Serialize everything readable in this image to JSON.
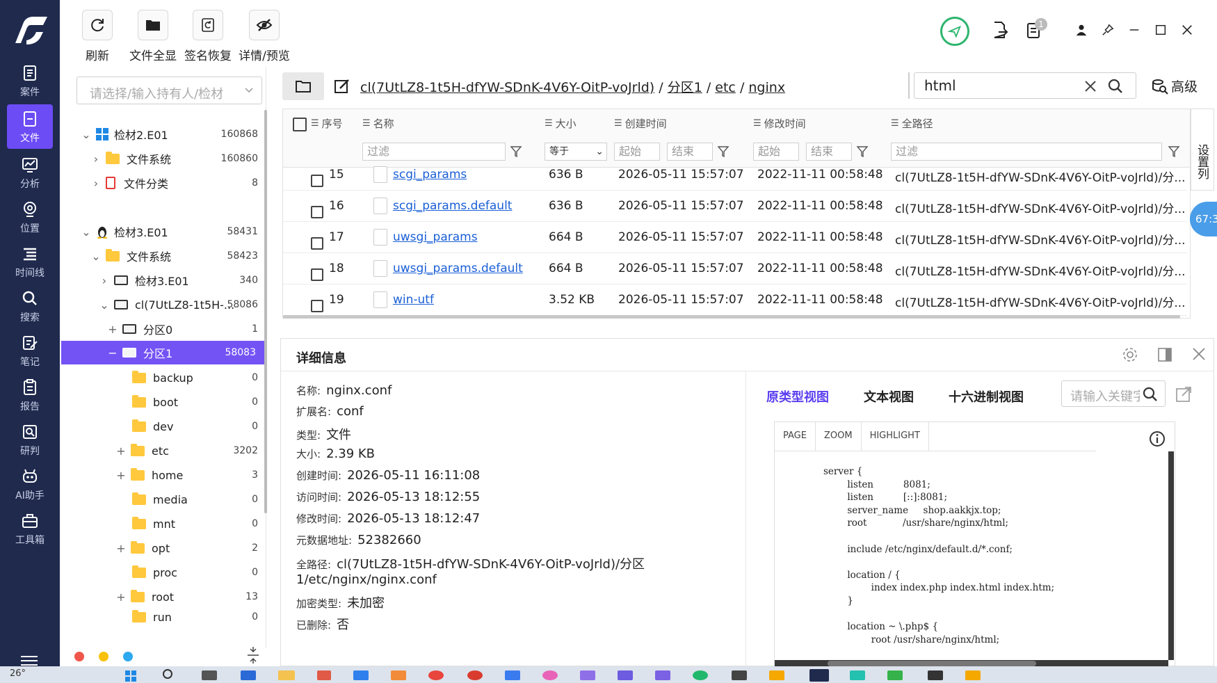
{
  "toolbar": {
    "refresh": "刷新",
    "all_files": "文件全显",
    "sig_restore": "签名恢复",
    "detail_preview": "详情/预览"
  },
  "rail": {
    "items": [
      {
        "label": "案件"
      },
      {
        "label": "文件"
      },
      {
        "label": "分析"
      },
      {
        "label": "位置"
      },
      {
        "label": "时间线"
      },
      {
        "label": "搜索"
      },
      {
        "label": "笔记"
      },
      {
        "label": "报告"
      },
      {
        "label": "研判"
      },
      {
        "label": "AI助手"
      },
      {
        "label": "工具箱"
      }
    ]
  },
  "header": {
    "badge_count": "1"
  },
  "owner_select": {
    "placeholder": "请选择/输入持有人/检材"
  },
  "tree": [
    {
      "label": "检材2.E01",
      "count": "160868"
    },
    {
      "label": "文件系统",
      "count": "160860"
    },
    {
      "label": "文件分类",
      "count": "8"
    },
    {
      "label": "检材3.E01",
      "count": "58431"
    },
    {
      "label": "文件系统",
      "count": "58423"
    },
    {
      "label": "检材3.E01",
      "count": "340"
    },
    {
      "label": "cl(7UtLZ8-1t5H-...",
      "count": "58086"
    },
    {
      "label": "分区0",
      "count": "1"
    },
    {
      "label": "分区1",
      "count": "58083"
    },
    {
      "label": "backup",
      "count": "0"
    },
    {
      "label": "boot",
      "count": "0"
    },
    {
      "label": "dev",
      "count": "0"
    },
    {
      "label": "etc",
      "count": "3202"
    },
    {
      "label": "home",
      "count": "3"
    },
    {
      "label": "media",
      "count": "0"
    },
    {
      "label": "mnt",
      "count": "0"
    },
    {
      "label": "opt",
      "count": "2"
    },
    {
      "label": "proc",
      "count": "0"
    },
    {
      "label": "root",
      "count": "13"
    },
    {
      "label": "run",
      "count": "0"
    }
  ],
  "path": {
    "root": "cl(7UtLZ8-1t5H-dfYW-SDnK-4V6Y-OitP-voJrld)",
    "sep": "/",
    "p1": "分区1",
    "p2": "etc",
    "p3": "nginx"
  },
  "search": {
    "value": "html",
    "advanced": "高级"
  },
  "grid": {
    "columns": {
      "index": "序号",
      "name": "名称",
      "size": "大小",
      "created": "创建时间",
      "modified": "修改时间",
      "fullpath": "全路径"
    },
    "filters": {
      "filter": "过滤",
      "equals": "等于",
      "start": "起始",
      "end": "结束"
    },
    "side_label": "设置列",
    "rows": [
      {
        "index": "15",
        "name": "scgi_params",
        "size": "636 B",
        "created": "2026-05-11 15:57:07",
        "modified": "2022-11-11 00:58:48",
        "path": "cl(7UtLZ8-1t5H-dfYW-SDnK-4V6Y-OitP-voJrld)/分..."
      },
      {
        "index": "16",
        "name": "scgi_params.default",
        "size": "636 B",
        "created": "2026-05-11 15:57:07",
        "modified": "2022-11-11 00:58:48",
        "path": "cl(7UtLZ8-1t5H-dfYW-SDnK-4V6Y-OitP-voJrld)/分..."
      },
      {
        "index": "17",
        "name": "uwsgi_params",
        "size": "664 B",
        "created": "2026-05-11 15:57:07",
        "modified": "2022-11-11 00:58:48",
        "path": "cl(7UtLZ8-1t5H-dfYW-SDnK-4V6Y-OitP-voJrld)/分..."
      },
      {
        "index": "18",
        "name": "uwsgi_params.default",
        "size": "664 B",
        "created": "2026-05-11 15:57:07",
        "modified": "2022-11-11 00:58:48",
        "path": "cl(7UtLZ8-1t5H-dfYW-SDnK-4V6Y-OitP-voJrld)/分..."
      },
      {
        "index": "19",
        "name": "win-utf",
        "size": "3.52 KB",
        "created": "2026-05-11 15:57:07",
        "modified": "2022-11-11 00:58:48",
        "path": "cl(7UtLZ8-1t5H-dfYW-SDnK-4V6Y-OitP-voJrld)/分..."
      }
    ]
  },
  "float_badge": "67:3",
  "details": {
    "title": "详细信息",
    "fields": [
      {
        "label": "名称:",
        "value": "nginx.conf"
      },
      {
        "label": "扩展名:",
        "value": "conf"
      },
      {
        "label": "类型:",
        "value": "文件"
      },
      {
        "label": "大小:",
        "value": "2.39 KB"
      },
      {
        "label": "创建时间:",
        "value": "2026-05-11 16:11:08"
      },
      {
        "label": "访问时间:",
        "value": "2026-05-13 18:12:55"
      },
      {
        "label": "修改时间:",
        "value": "2026-05-13 18:12:47"
      },
      {
        "label": "元数据地址:",
        "value": "52382660"
      },
      {
        "label": "全路径:",
        "value": "cl(7UtLZ8-1t5H-dfYW-SDnK-4V6Y-OitP-voJrld)/分区"
      },
      {
        "label": "",
        "value": "1/etc/nginx/nginx.conf"
      },
      {
        "label": "加密类型:",
        "value": "未加密"
      },
      {
        "label": "已删除:",
        "value": "否"
      }
    ],
    "tabs": {
      "prototype": "原类型视图",
      "text": "文本视图",
      "hex": "十六进制视图"
    },
    "keyword_placeholder": "请输入关键字",
    "viewer_tabs": {
      "page": "PAGE",
      "zoom": "ZOOM",
      "highlight": "HIGHLIGHT"
    },
    "code": "server {\n        listen          8081;\n        listen          [::]:8081;\n        server_name     shop.aakkjx.top;\n        root            /usr/share/nginx/html;\n\n        include /etc/nginx/default.d/*.conf;\n\n        location / {\n                index index.php index.html index.htm;\n        }\n\n        location ~ \\.php$ {\n                root /usr/share/nginx/html;"
  },
  "taskbar": {
    "temperature": "26°"
  },
  "colors": {
    "rail": "#1f2a4d",
    "accent": "#7453f5",
    "link": "#1a5fd6",
    "tab_active": "#5b3ff0"
  }
}
